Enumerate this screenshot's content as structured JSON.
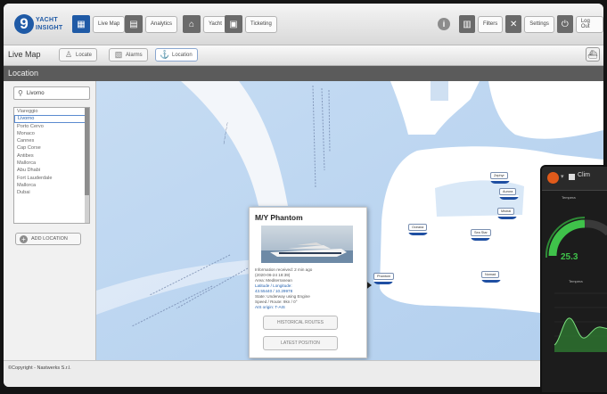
{
  "app": {
    "logo_line1": "YACHT",
    "logo_line2": "INSIGHT",
    "logo_glyph": "9"
  },
  "nav": [
    {
      "label": "Live Map",
      "icon": "map-icon",
      "active": true
    },
    {
      "label": "Analytics",
      "icon": "chart-icon",
      "active": false
    },
    {
      "label": "Yacht",
      "icon": "home-icon",
      "active": false
    },
    {
      "label": "Ticketing",
      "icon": "ticket-icon",
      "active": false
    }
  ],
  "header_right": [
    {
      "label": "Filters",
      "icon": "filter-icon"
    },
    {
      "label": "Settings",
      "icon": "wrench-icon"
    },
    {
      "label": "Log Out",
      "icon": "logout-icon"
    }
  ],
  "subbar": {
    "title": "Live Map",
    "tools": [
      {
        "label": "Locate",
        "icon": "person-pin-icon",
        "active": false
      },
      {
        "label": "Alarms",
        "icon": "alarm-icon",
        "active": false
      },
      {
        "label": "Location",
        "icon": "anchor-icon",
        "active": true
      }
    ]
  },
  "section": {
    "title": "Location"
  },
  "sidebar": {
    "search_value": "Livorno",
    "locations": [
      "Viareggio",
      "Livorno",
      "Porto Cervo",
      "Monaco",
      "Cannes",
      "Cap Corse",
      "Antibes",
      "Mallorca",
      "Abu Dhabi",
      "Fort Lauderdale",
      "Mallorca",
      "Dubai"
    ],
    "selected_index": 1,
    "add_label": "ADD LOCATION"
  },
  "map": {
    "water_color": "#bcd6f2",
    "land_color": "#ffffff",
    "vessels": [
      {
        "label": "Phantom"
      },
      {
        "label": "Sea Star"
      },
      {
        "label": "Oceana"
      },
      {
        "label": "Nomad"
      },
      {
        "label": "Zephyr"
      },
      {
        "label": "Aurora"
      },
      {
        "label": "Mistral"
      }
    ]
  },
  "popup": {
    "title": "M/Y Phantom",
    "lines": [
      "Information received: 2 min ago",
      "(2020-06-24 18:39)",
      "Area: Mediterranean",
      "Latitude / Longitude:",
      "43.55440 / 10.29978",
      "State: Underway using Engine",
      "Speed / Route: 9kn / 0°",
      "AIS origin: T-AIS"
    ],
    "blue_lines": [
      3,
      4,
      7
    ],
    "btn_history": "HISTORICAL ROUTES",
    "btn_latest": "LATEST POSITION"
  },
  "footer": {
    "copyright": "©Copyright - Nastwerks S.r.l."
  },
  "dashboard": {
    "title": "Clim",
    "panel1_title": "Tempera",
    "gauge_value": "25.3",
    "panel2_title": "Tempera",
    "accent": "#3fc24a"
  }
}
